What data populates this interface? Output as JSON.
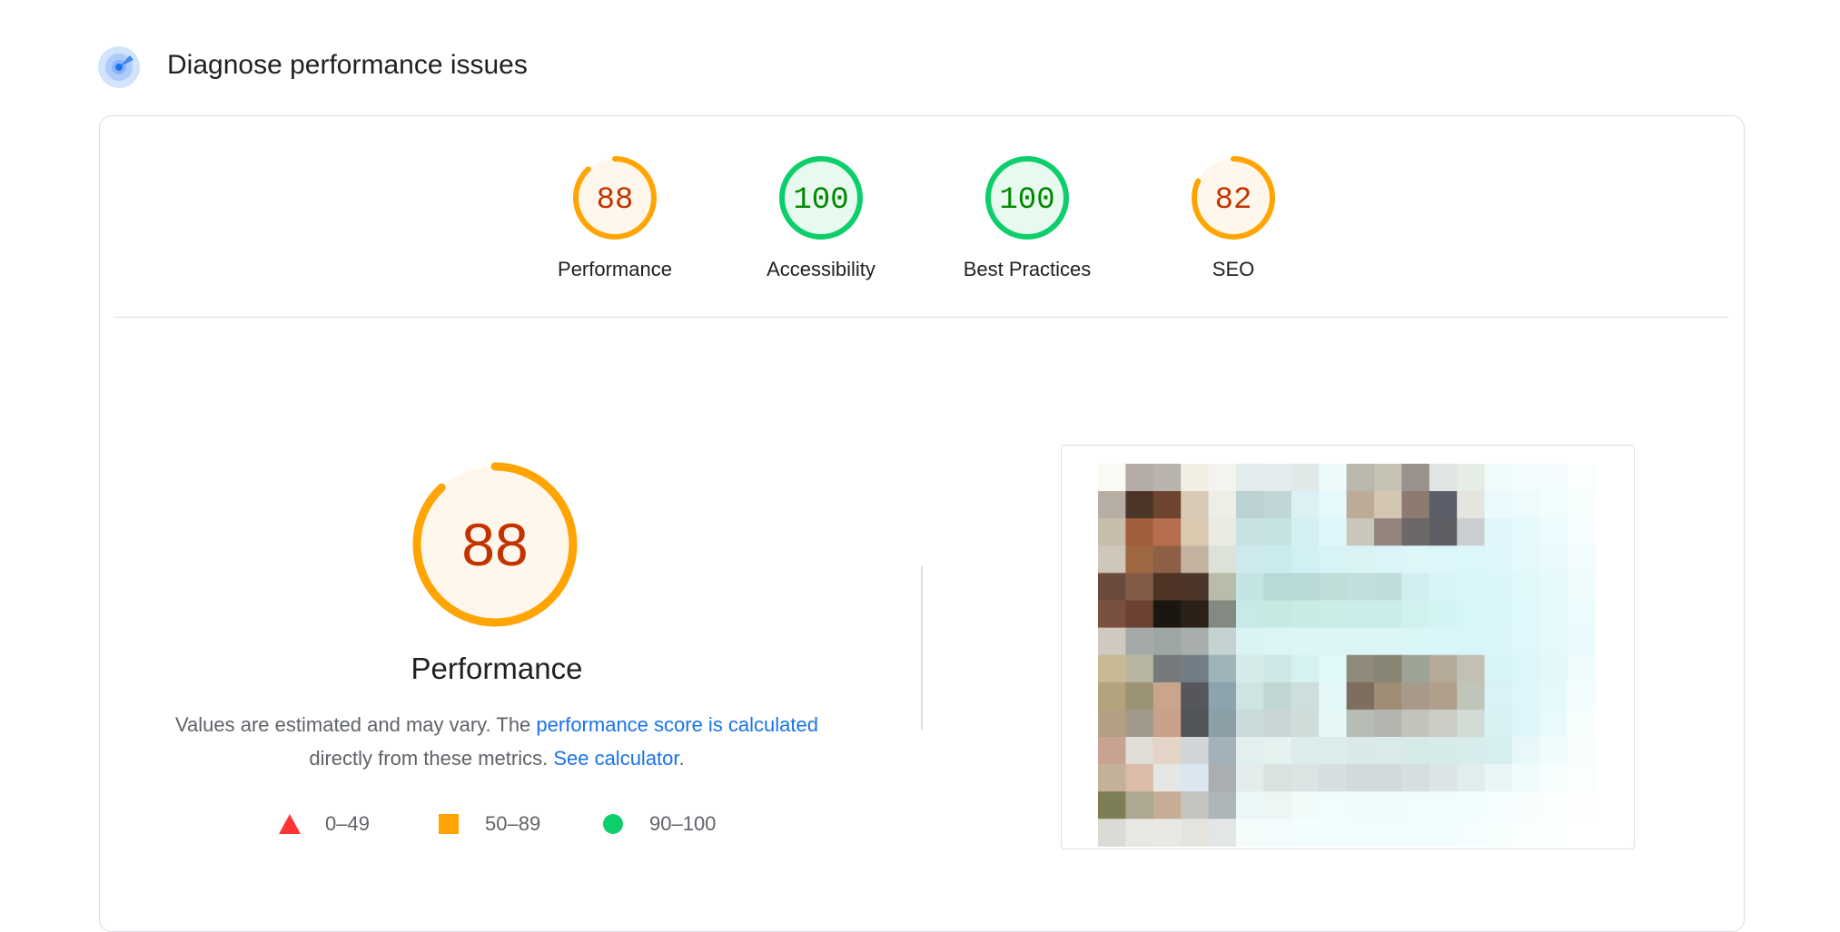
{
  "section": {
    "title": "Diagnose performance issues",
    "icon": "lighthouse-icon"
  },
  "gauges": [
    {
      "label": "Performance",
      "score": "88",
      "value": 0.88,
      "rating": "average"
    },
    {
      "label": "Accessibility",
      "score": "100",
      "value": 1.0,
      "rating": "pass"
    },
    {
      "label": "Best Practices",
      "score": "100",
      "value": 1.0,
      "rating": "pass"
    },
    {
      "label": "SEO",
      "score": "82",
      "value": 0.82,
      "rating": "average"
    }
  ],
  "performance": {
    "score": "88",
    "value": 0.88,
    "title": "Performance",
    "desc_prefix": "Values are estimated and may vary. The ",
    "link1": "performance score is calculated",
    "desc_middle": " directly from these metrics. ",
    "link2": "See calculator",
    "desc_suffix": "."
  },
  "legend": [
    {
      "range": "0–49",
      "shape": "triangle-icon"
    },
    {
      "range": "50–89",
      "shape": "square-icon"
    },
    {
      "range": "90–100",
      "shape": "circle-icon"
    }
  ],
  "colors": {
    "average_stroke": "#ffa400",
    "average_fill": "#fff7ec",
    "average_text": "#c33300",
    "pass_stroke": "#0cce6b",
    "pass_fill": "#e8f9ef",
    "pass_text": "#008800",
    "fail": "#ff3333",
    "link": "#1a73e8"
  }
}
